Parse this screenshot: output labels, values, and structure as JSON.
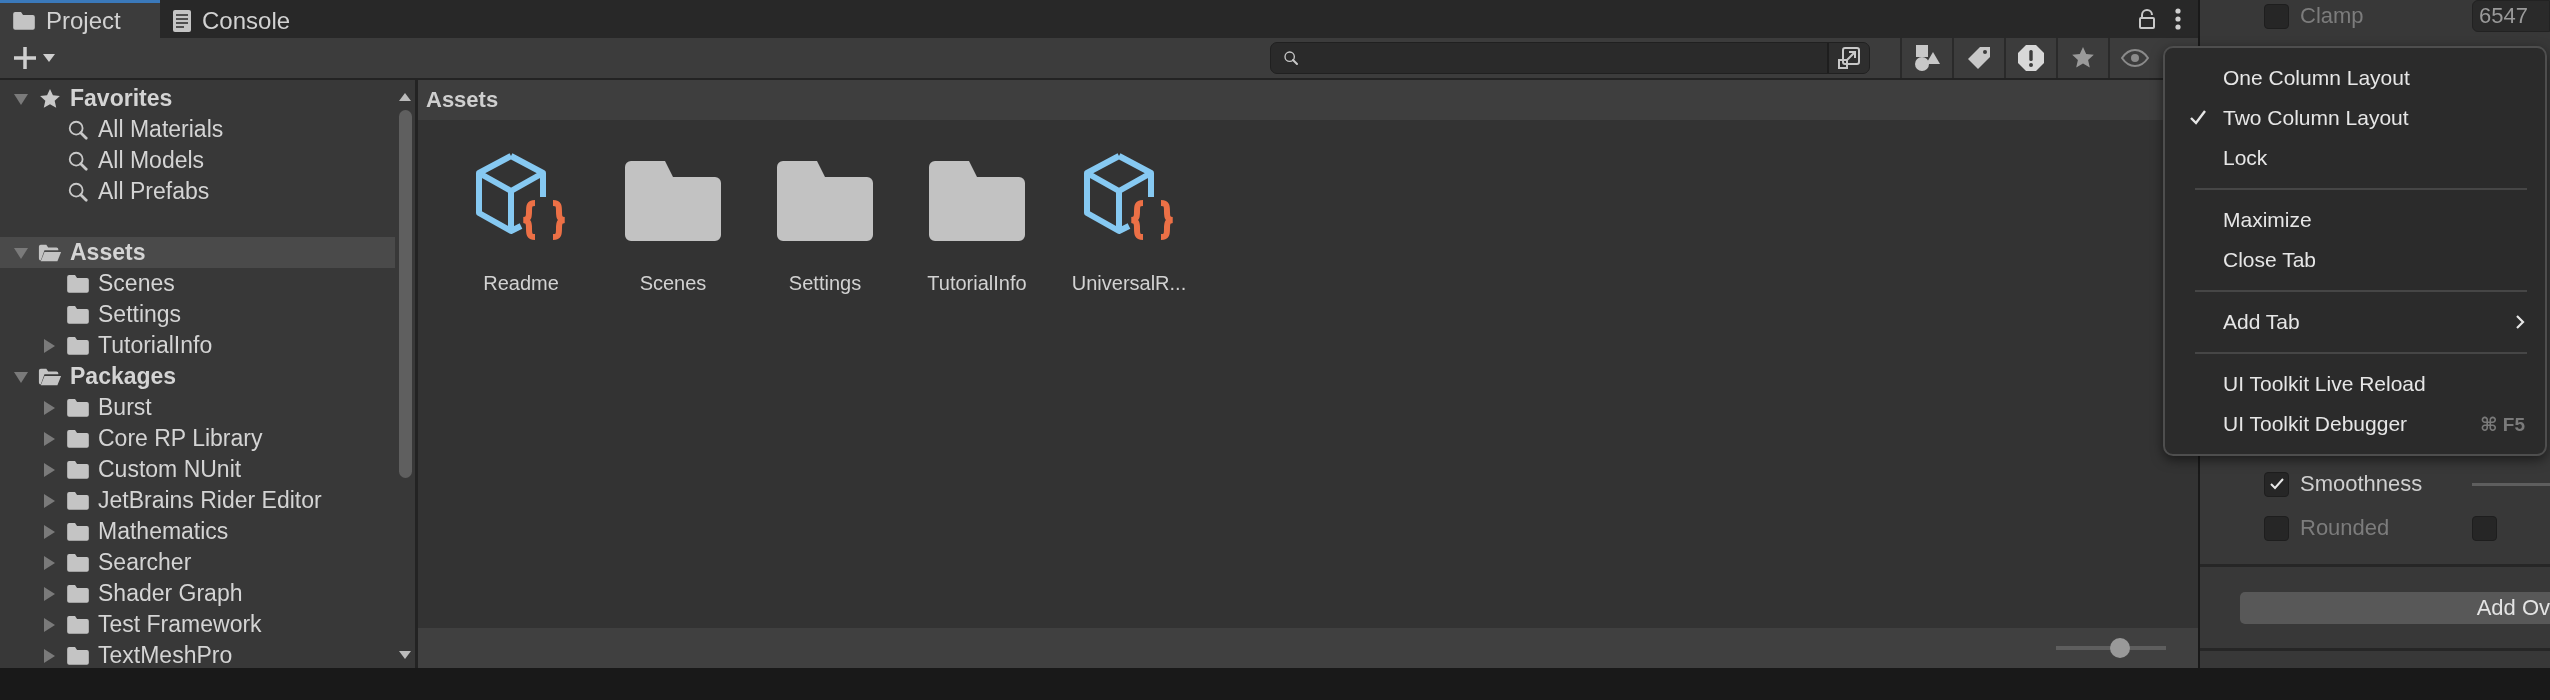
{
  "tabs": [
    {
      "label": "Project",
      "selected": true
    },
    {
      "label": "Console",
      "selected": false
    }
  ],
  "favorites": {
    "label": "Favorites",
    "expanded": true,
    "selected": false,
    "children": [
      {
        "label": "All Materials",
        "selected": false
      },
      {
        "label": "All Models",
        "selected": false
      },
      {
        "label": "All Prefabs",
        "selected": false
      }
    ]
  },
  "tree": [
    {
      "label": "Assets",
      "expanded": true,
      "selected": true,
      "children": [
        {
          "label": "Scenes",
          "selected": false
        },
        {
          "label": "Settings",
          "selected": false
        },
        {
          "label": "TutorialInfo",
          "expanded": false,
          "selected": false
        }
      ]
    },
    {
      "label": "Packages",
      "expanded": true,
      "selected": false,
      "children": [
        {
          "label": "Burst",
          "expanded": false,
          "selected": false
        },
        {
          "label": "Core RP Library",
          "expanded": false,
          "selected": false
        },
        {
          "label": "Custom NUnit",
          "expanded": false,
          "selected": false
        },
        {
          "label": "JetBrains Rider Editor",
          "expanded": false,
          "selected": false
        },
        {
          "label": "Mathematics",
          "expanded": false,
          "selected": false
        },
        {
          "label": "Searcher",
          "expanded": false,
          "selected": false
        },
        {
          "label": "Shader Graph",
          "expanded": false,
          "selected": false
        },
        {
          "label": "Test Framework",
          "expanded": false,
          "selected": false
        },
        {
          "label": "TextMeshPro",
          "expanded": false,
          "selected": false
        }
      ]
    }
  ],
  "breadcrumb": "Assets",
  "assets": [
    {
      "label": "Readme",
      "kind": "asset"
    },
    {
      "label": "Scenes",
      "kind": "folder"
    },
    {
      "label": "Settings",
      "kind": "folder"
    },
    {
      "label": "TutorialInfo",
      "kind": "folder"
    },
    {
      "label": "UniversalR...",
      "kind": "asset"
    }
  ],
  "zoom_slider": {
    "level": 0.58
  },
  "menu": {
    "groups": [
      {
        "items": [
          {
            "label": "One Column Layout",
            "checked": false,
            "submenu": false
          },
          {
            "label": "Two Column Layout",
            "checked": true,
            "submenu": false
          },
          {
            "label": "Lock",
            "checked": false,
            "submenu": false
          }
        ]
      },
      {
        "items": [
          {
            "label": "Maximize",
            "checked": false,
            "submenu": false
          },
          {
            "label": "Close Tab",
            "checked": false,
            "submenu": false
          }
        ]
      },
      {
        "items": [
          {
            "label": "Add Tab",
            "checked": false,
            "submenu": true
          }
        ]
      },
      {
        "items": [
          {
            "label": "UI Toolkit Live Reload",
            "checked": false,
            "submenu": false
          },
          {
            "label": "UI Toolkit Debugger",
            "checked": false,
            "submenu": false,
            "shortcut": "⌘ F5"
          }
        ]
      }
    ]
  },
  "inspector": {
    "rows": [
      {
        "kind": "field",
        "label": "Clamp",
        "checked": false,
        "disabled": true,
        "value": "6547"
      },
      {
        "kind": "slider",
        "label": "Smoothness",
        "checked": true,
        "disabled": false
      },
      {
        "kind": "toggle",
        "label": "Rounded",
        "checked": false,
        "disabled": true,
        "toggle_checked": false
      }
    ],
    "button": "Add Ov"
  }
}
